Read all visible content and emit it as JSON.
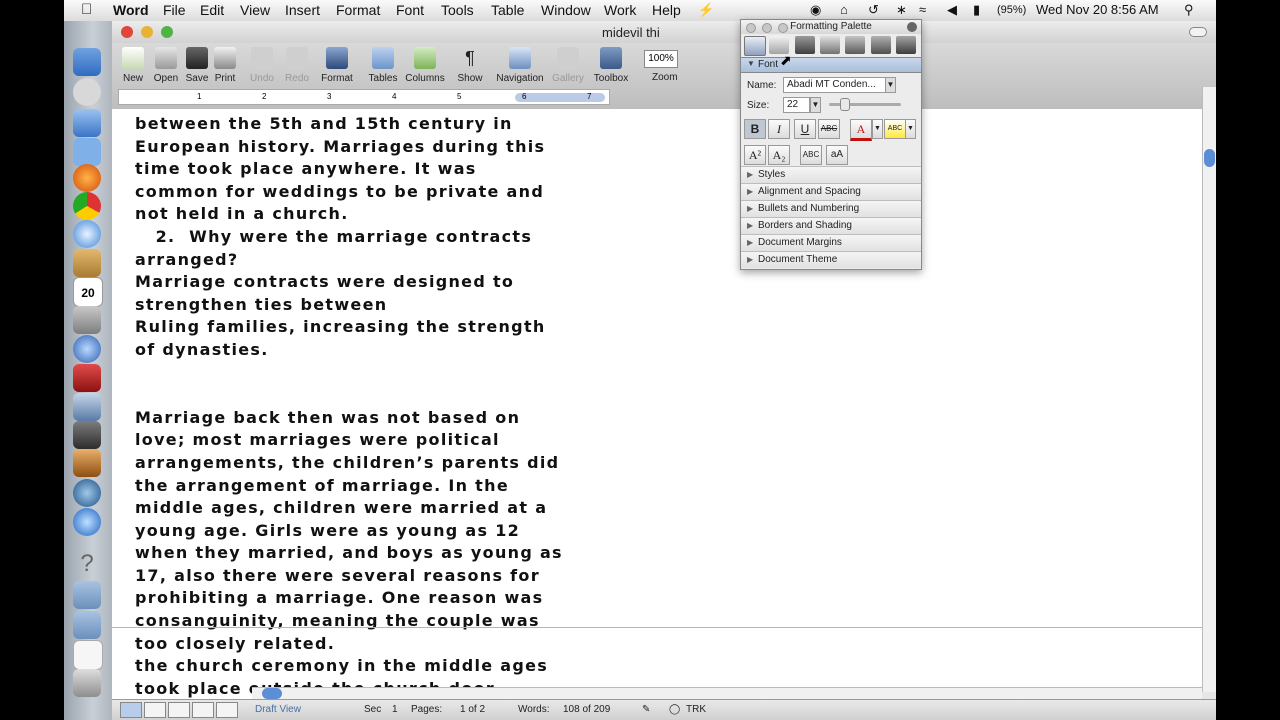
{
  "menubar": {
    "app_name": "Word",
    "menus": [
      "File",
      "Edit",
      "View",
      "Insert",
      "Format",
      "Font",
      "Tools",
      "Table",
      "Window",
      "Work",
      "Help"
    ],
    "battery": "(95%)",
    "clock": "Wed Nov 20  8:56 AM"
  },
  "window": {
    "title": "midevil thi"
  },
  "toolbar": {
    "buttons": [
      "New",
      "Open",
      "Save",
      "Print",
      "Undo",
      "Redo",
      "Format",
      "Tables",
      "Columns",
      "Show",
      "Navigation",
      "Gallery",
      "Toolbox"
    ],
    "zoom_value": "100%",
    "zoom_label": "Zoom"
  },
  "ruler": {
    "ticks": [
      "1",
      "2",
      "3",
      "4",
      "5",
      "6",
      "7"
    ]
  },
  "document": {
    "lines": [
      "between the 5th and 15th century in",
      "European history. Marriages during this",
      "time took place anywhere. It was",
      "common for weddings to be private and",
      "not held in a church.",
      "   2.  Why were the marriage contracts",
      "arranged?",
      "Marriage contracts were designed to",
      "strengthen ties between",
      "Ruling families, increasing the strength",
      "of dynasties.",
      "",
      "",
      "Marriage back then was not based on",
      "love; most marriages were political",
      "arrangements, the children’s parents did",
      "the arrangement of marriage. In the",
      "middle ages, children were married at a",
      "young age. Girls were as young as 12",
      "when they married, and boys as young as",
      "17, also there were several reasons for",
      "prohibiting a marriage. One reason was",
      "consanguinity, meaning the couple was",
      "too closely related.",
      "the church ceremony in the middle ages",
      "took place outside the church door"
    ]
  },
  "statusbar": {
    "view": "Draft View",
    "sec_label": "Sec",
    "sec_value": "1",
    "pages_label": "Pages:",
    "pages_value": "1 of 2",
    "words_label": "Words:",
    "words_value": "108 of 209",
    "trk": "TRK"
  },
  "palette": {
    "title": "Formatting Palette",
    "font_section": "Font",
    "name_label": "Name:",
    "name_value": "Abadi MT Conden...",
    "size_label": "Size:",
    "size_value": "22",
    "style_buttons": [
      "B",
      "I",
      "U",
      "ABC"
    ],
    "sections": [
      "Styles",
      "Alignment and Spacing",
      "Bullets and Numbering",
      "Borders and Shading",
      "Document Margins",
      "Document Theme"
    ]
  },
  "calendar_day": "20"
}
